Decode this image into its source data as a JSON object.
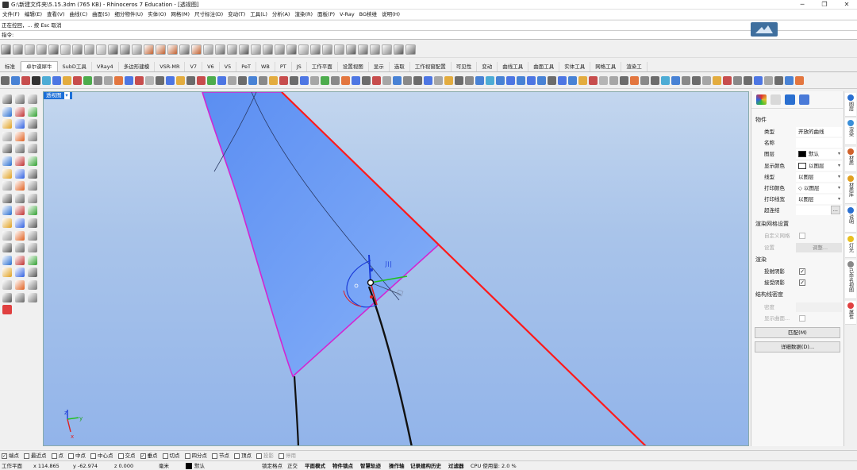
{
  "title": "G:\\新建文件夹\\5.15.3dm (765 KB) - Rhinoceros 7 Education - [透视图]",
  "menu": [
    "文件(F)",
    "编辑(E)",
    "查看(V)",
    "曲线(C)",
    "曲面(S)",
    "细分物件(U)",
    "实体(O)",
    "网格(M)",
    "尺寸标注(D)",
    "变动(T)",
    "工具(L)",
    "分析(A)",
    "渲染(R)",
    "面板(P)",
    "V-Ray",
    "BG椟维",
    "说明(H)"
  ],
  "command": {
    "history": "正在控回，... 按 Esc 取消",
    "prompt": "指令:",
    "value": ""
  },
  "tabs": [
    "标准",
    "卓尔谟犀牛",
    "SubD工具",
    "VRay4",
    "多边形建模",
    "VSR-MR",
    "V7",
    "V6",
    "V5",
    "PeT",
    "WB",
    "PT",
    "JS",
    "工作平面",
    "设置视图",
    "显示",
    "选取",
    "工作视窗配置",
    "可见性",
    "变动",
    "曲线工具",
    "曲面工具",
    "实体工具",
    "网格工具",
    "渲染工"
  ],
  "active_tab_index": 1,
  "viewport": {
    "label": "透视图",
    "arrow": "▾",
    "gumball_label": "川",
    "axes": {
      "x": "x",
      "y": "y",
      "z": "z"
    }
  },
  "panel": {
    "section_object": "物件",
    "rows": [
      {
        "k": "类型",
        "v": "开放的曲线",
        "dd": false
      },
      {
        "k": "名称",
        "v": "",
        "dd": false
      },
      {
        "k": "图层",
        "v": "默认",
        "dd": true,
        "swatch": "#000000"
      },
      {
        "k": "显示颜色",
        "v": "以图层",
        "dd": true,
        "swatch": "#ffffff"
      },
      {
        "k": "线型",
        "v": "以图层",
        "dd": true
      },
      {
        "k": "打印颜色",
        "v": "以图层",
        "dd": true,
        "diamond": true
      },
      {
        "k": "打印线宽",
        "v": "以图层",
        "dd": true
      },
      {
        "k": "超连结",
        "v": "",
        "dd": false,
        "more": "..."
      }
    ],
    "section_mesh": "渲染网格设置",
    "custom_mesh": "自定义网格",
    "settings": "设置",
    "adjust": "调整...",
    "section_render": "渲染",
    "cast_shadow": "投射阴影",
    "receive_shadow": "接受阴影",
    "section_iso": "结构线密度",
    "density": "密度",
    "show_surface": "显示曲面...",
    "match_btn": "匹配(M)",
    "details_btn": "详细数据(D)..."
  },
  "side_tabs": [
    {
      "label": "图层",
      "color": "#2a6fd0"
    },
    {
      "label": "渲染",
      "color": "#3a8fd8"
    },
    {
      "label": "材质",
      "color": "#d0612a"
    },
    {
      "label": "材质库",
      "color": "#e0a020"
    },
    {
      "label": "说明",
      "color": "#2a6fd0"
    },
    {
      "label": "灯光",
      "color": "#e8c020"
    },
    {
      "label": "已命名视图",
      "color": "#888888"
    },
    {
      "label": "属性",
      "color": "#e04040"
    }
  ],
  "osnaps": [
    {
      "label": "端点",
      "checked": true
    },
    {
      "label": "最近点",
      "checked": false
    },
    {
      "label": "点",
      "checked": false
    },
    {
      "label": "中点",
      "checked": false
    },
    {
      "label": "中心点",
      "checked": false
    },
    {
      "label": "交点",
      "checked": false
    },
    {
      "label": "垂点",
      "checked": true
    },
    {
      "label": "切点",
      "checked": false
    },
    {
      "label": "四分点",
      "checked": false
    },
    {
      "label": "节点",
      "checked": false
    },
    {
      "label": "顶点",
      "checked": false
    },
    {
      "label": "投影",
      "checked": false
    },
    {
      "label": "停用",
      "checked": false
    }
  ],
  "status": {
    "cplane": "工作平面",
    "x": "x 114.865",
    "y": "y -62.974",
    "z": "z 0.000",
    "unit": "毫米",
    "layer": "默认",
    "items": [
      "锁定格点",
      "正交",
      "平面模式",
      "物件锁点",
      "智慧轨迹",
      "操作轴",
      "记录建构历史",
      "过滤器",
      "CPU 使用量: 2.0 %"
    ]
  },
  "colors": {
    "accent": "#1b6fd8",
    "surface": "#6f9ef5",
    "edge": "#d226d2",
    "red_line": "#ff1a1a"
  }
}
